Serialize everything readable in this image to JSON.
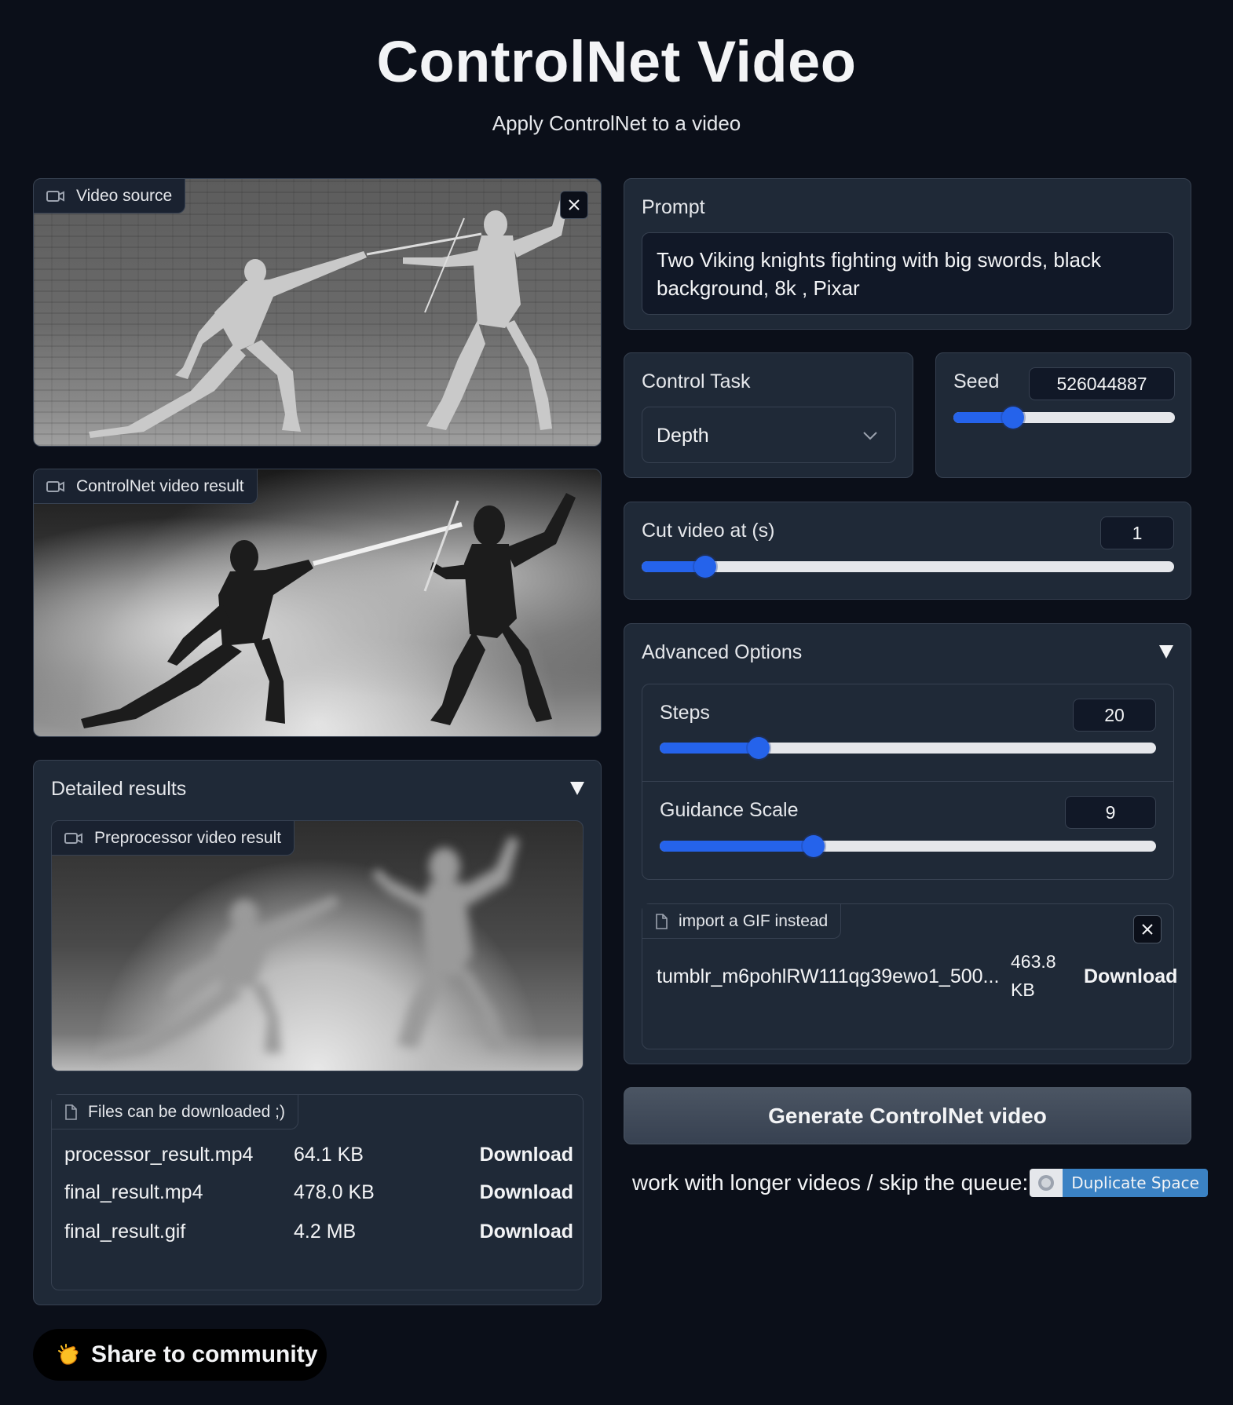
{
  "header": {
    "title": "ControlNet Video",
    "subtitle": "Apply ControlNet to a video"
  },
  "video_source": {
    "label": "Video source"
  },
  "controlnet_result": {
    "label": "ControlNet video result"
  },
  "detailed_results": {
    "title": "Detailed results",
    "preprocessor_label": "Preprocessor video result",
    "files_label": "Files can be downloaded ;)",
    "files": [
      {
        "name": "processor_result.mp4",
        "size": "64.1 KB",
        "action": "Download"
      },
      {
        "name": "final_result.mp4",
        "size": "478.0 KB",
        "action": "Download"
      },
      {
        "name": "final_result.gif",
        "size": "4.2 MB",
        "action": "Download"
      }
    ]
  },
  "share": {
    "label": "Share to community"
  },
  "prompt": {
    "label": "Prompt",
    "value": "Two Viking knights fighting with big swords, black background, 8k , Pixar"
  },
  "control_task": {
    "label": "Control Task",
    "value": "Depth"
  },
  "seed": {
    "label": "Seed",
    "value": "526044887",
    "fraction": 0.27
  },
  "cut_video": {
    "label": "Cut video at (s)",
    "value": "1",
    "fraction": 0.12
  },
  "advanced": {
    "title": "Advanced Options",
    "steps": {
      "label": "Steps",
      "value": "20",
      "fraction": 0.2
    },
    "guidance": {
      "label": "Guidance Scale",
      "value": "9",
      "fraction": 0.31
    }
  },
  "gif_import": {
    "label": "import a GIF instead",
    "file_name": "tumblr_m6pohlRW111qg39ewo1_500...",
    "file_size_line1": "463.8",
    "file_size_line2": "KB",
    "action": "Download"
  },
  "generate": {
    "label": "Generate ControlNet video"
  },
  "duplicate": {
    "text": "work with longer videos / skip the queue:",
    "badge": "Duplicate Space"
  },
  "colors": {
    "background": "#0b0f19",
    "panel": "#1f2937",
    "accent": "#2563eb",
    "badge": "#3b82c4"
  }
}
